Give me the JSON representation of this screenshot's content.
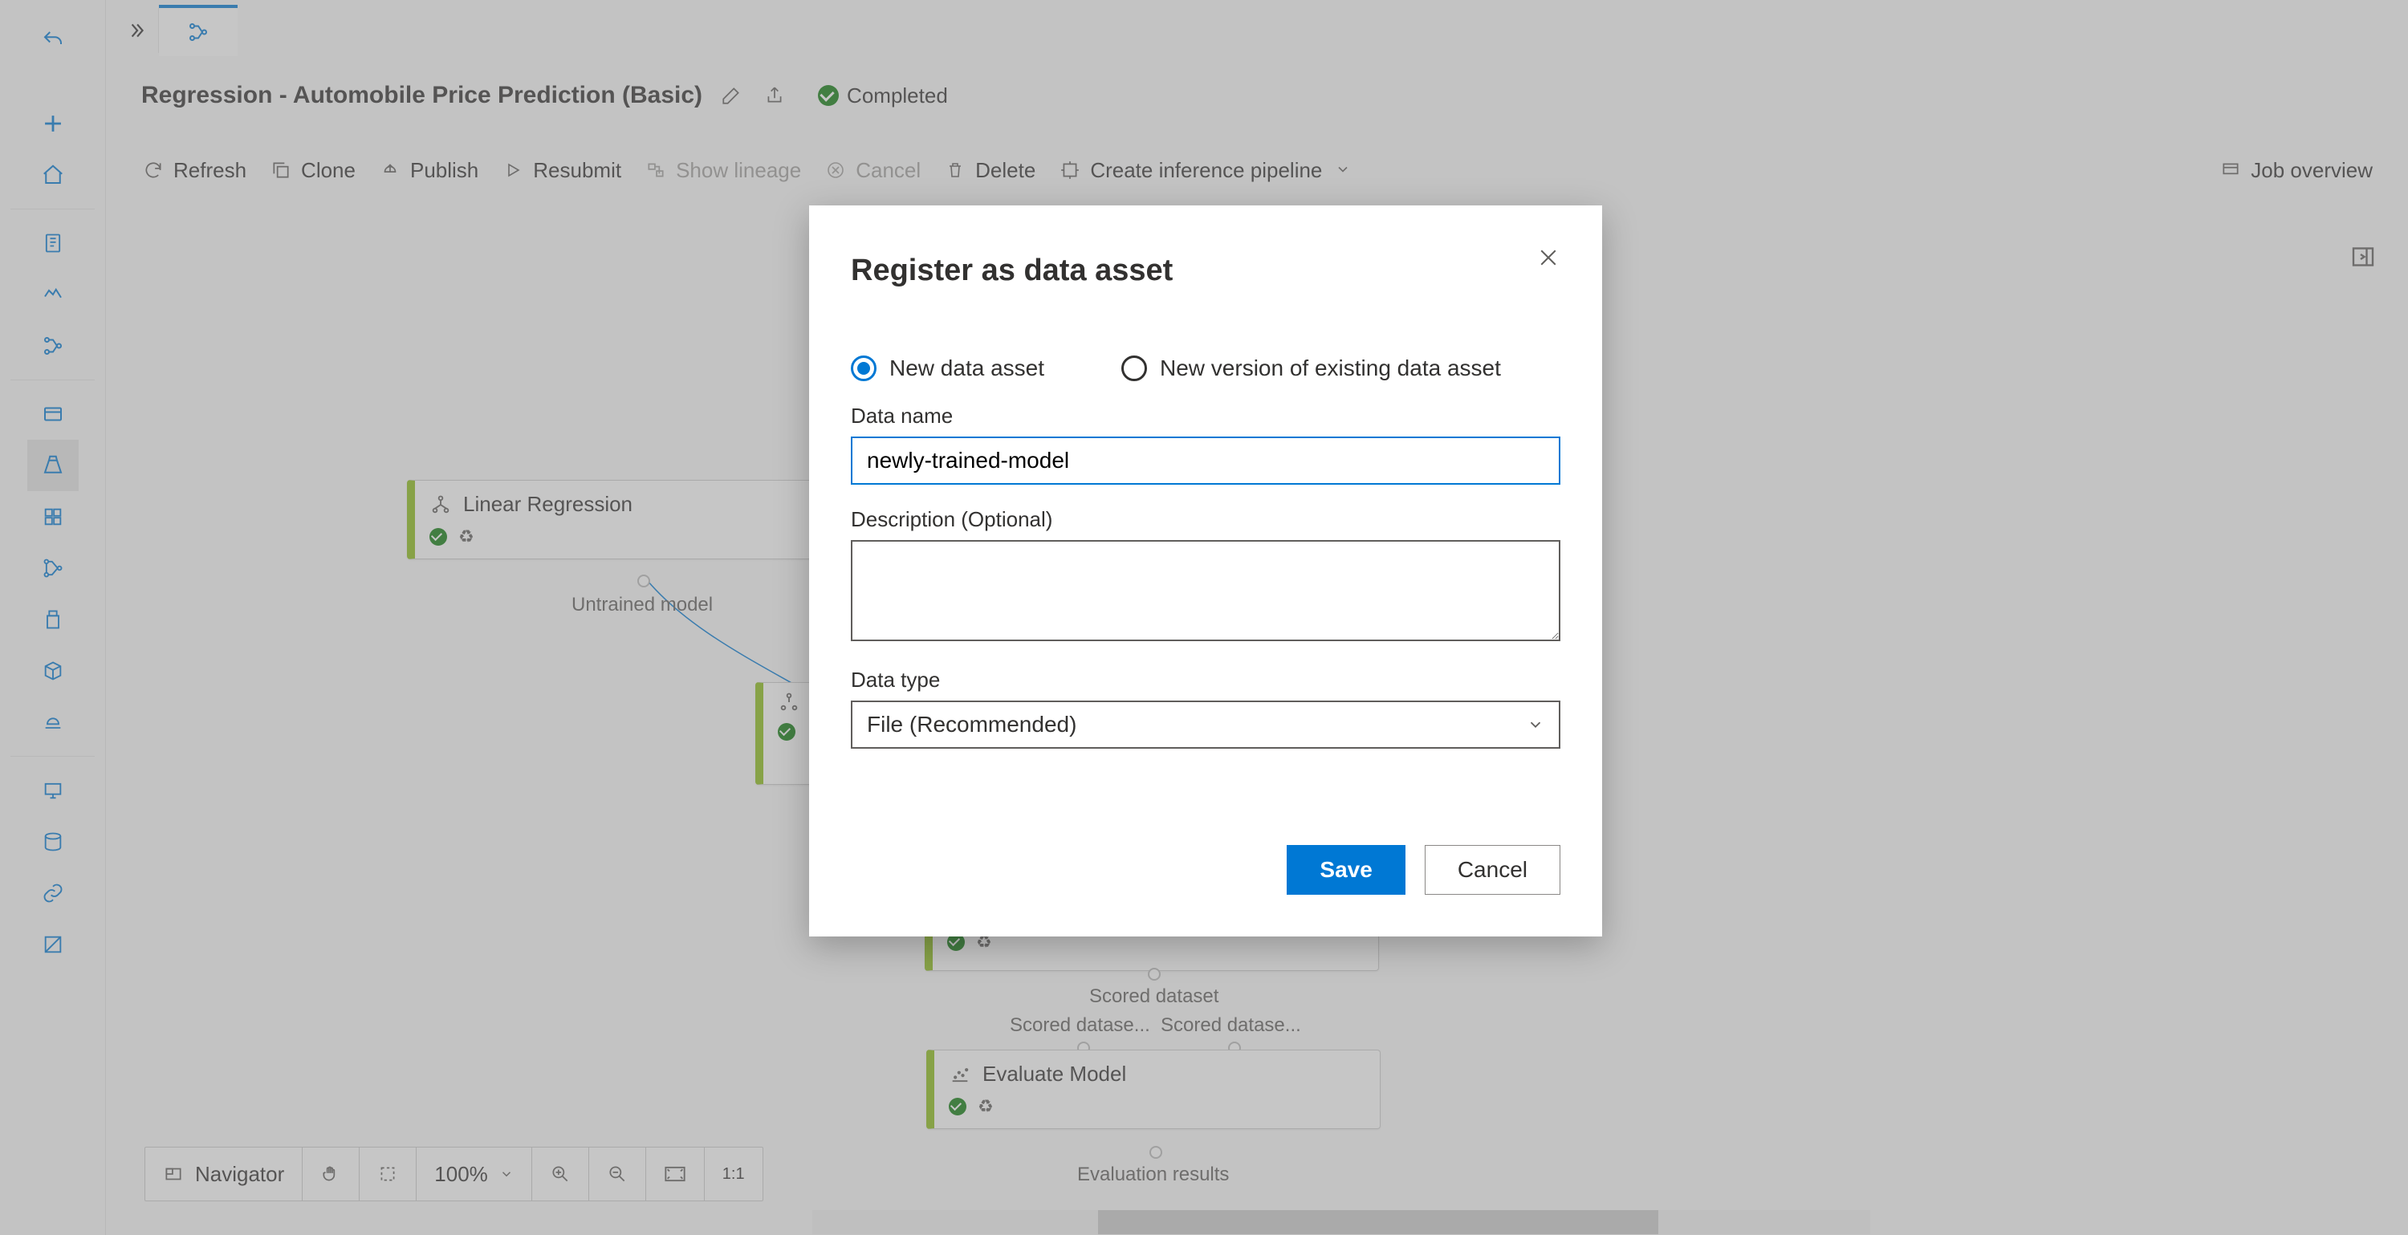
{
  "header": {
    "title": "Regression - Automobile Price Prediction (Basic)",
    "status_text": "Completed"
  },
  "toolbar": {
    "refresh": "Refresh",
    "clone": "Clone",
    "publish": "Publish",
    "resubmit": "Resubmit",
    "show_lineage": "Show lineage",
    "cancel": "Cancel",
    "delete": "Delete",
    "create_inference": "Create inference pipeline",
    "job_overview": "Job overview"
  },
  "canvas": {
    "nodes": {
      "linear_regression": {
        "title": "Linear Regression",
        "out_label": "Untrained model"
      },
      "evaluate_model": {
        "title": "Evaluate Model",
        "out_label": "Evaluation results"
      }
    },
    "labels": {
      "scored_dataset": "Scored dataset",
      "scored_left": "Scored datase...",
      "scored_right": "Scored datase..."
    }
  },
  "navigator": {
    "label": "Navigator",
    "zoom": "100%"
  },
  "modal": {
    "title": "Register as data asset",
    "radio_new": "New data asset",
    "radio_version": "New version of existing data asset",
    "data_name_label": "Data name",
    "data_name_value": "newly-trained-model",
    "description_label": "Description (Optional)",
    "data_type_label": "Data type",
    "data_type_value": "File (Recommended)",
    "save": "Save",
    "cancel": "Cancel"
  }
}
